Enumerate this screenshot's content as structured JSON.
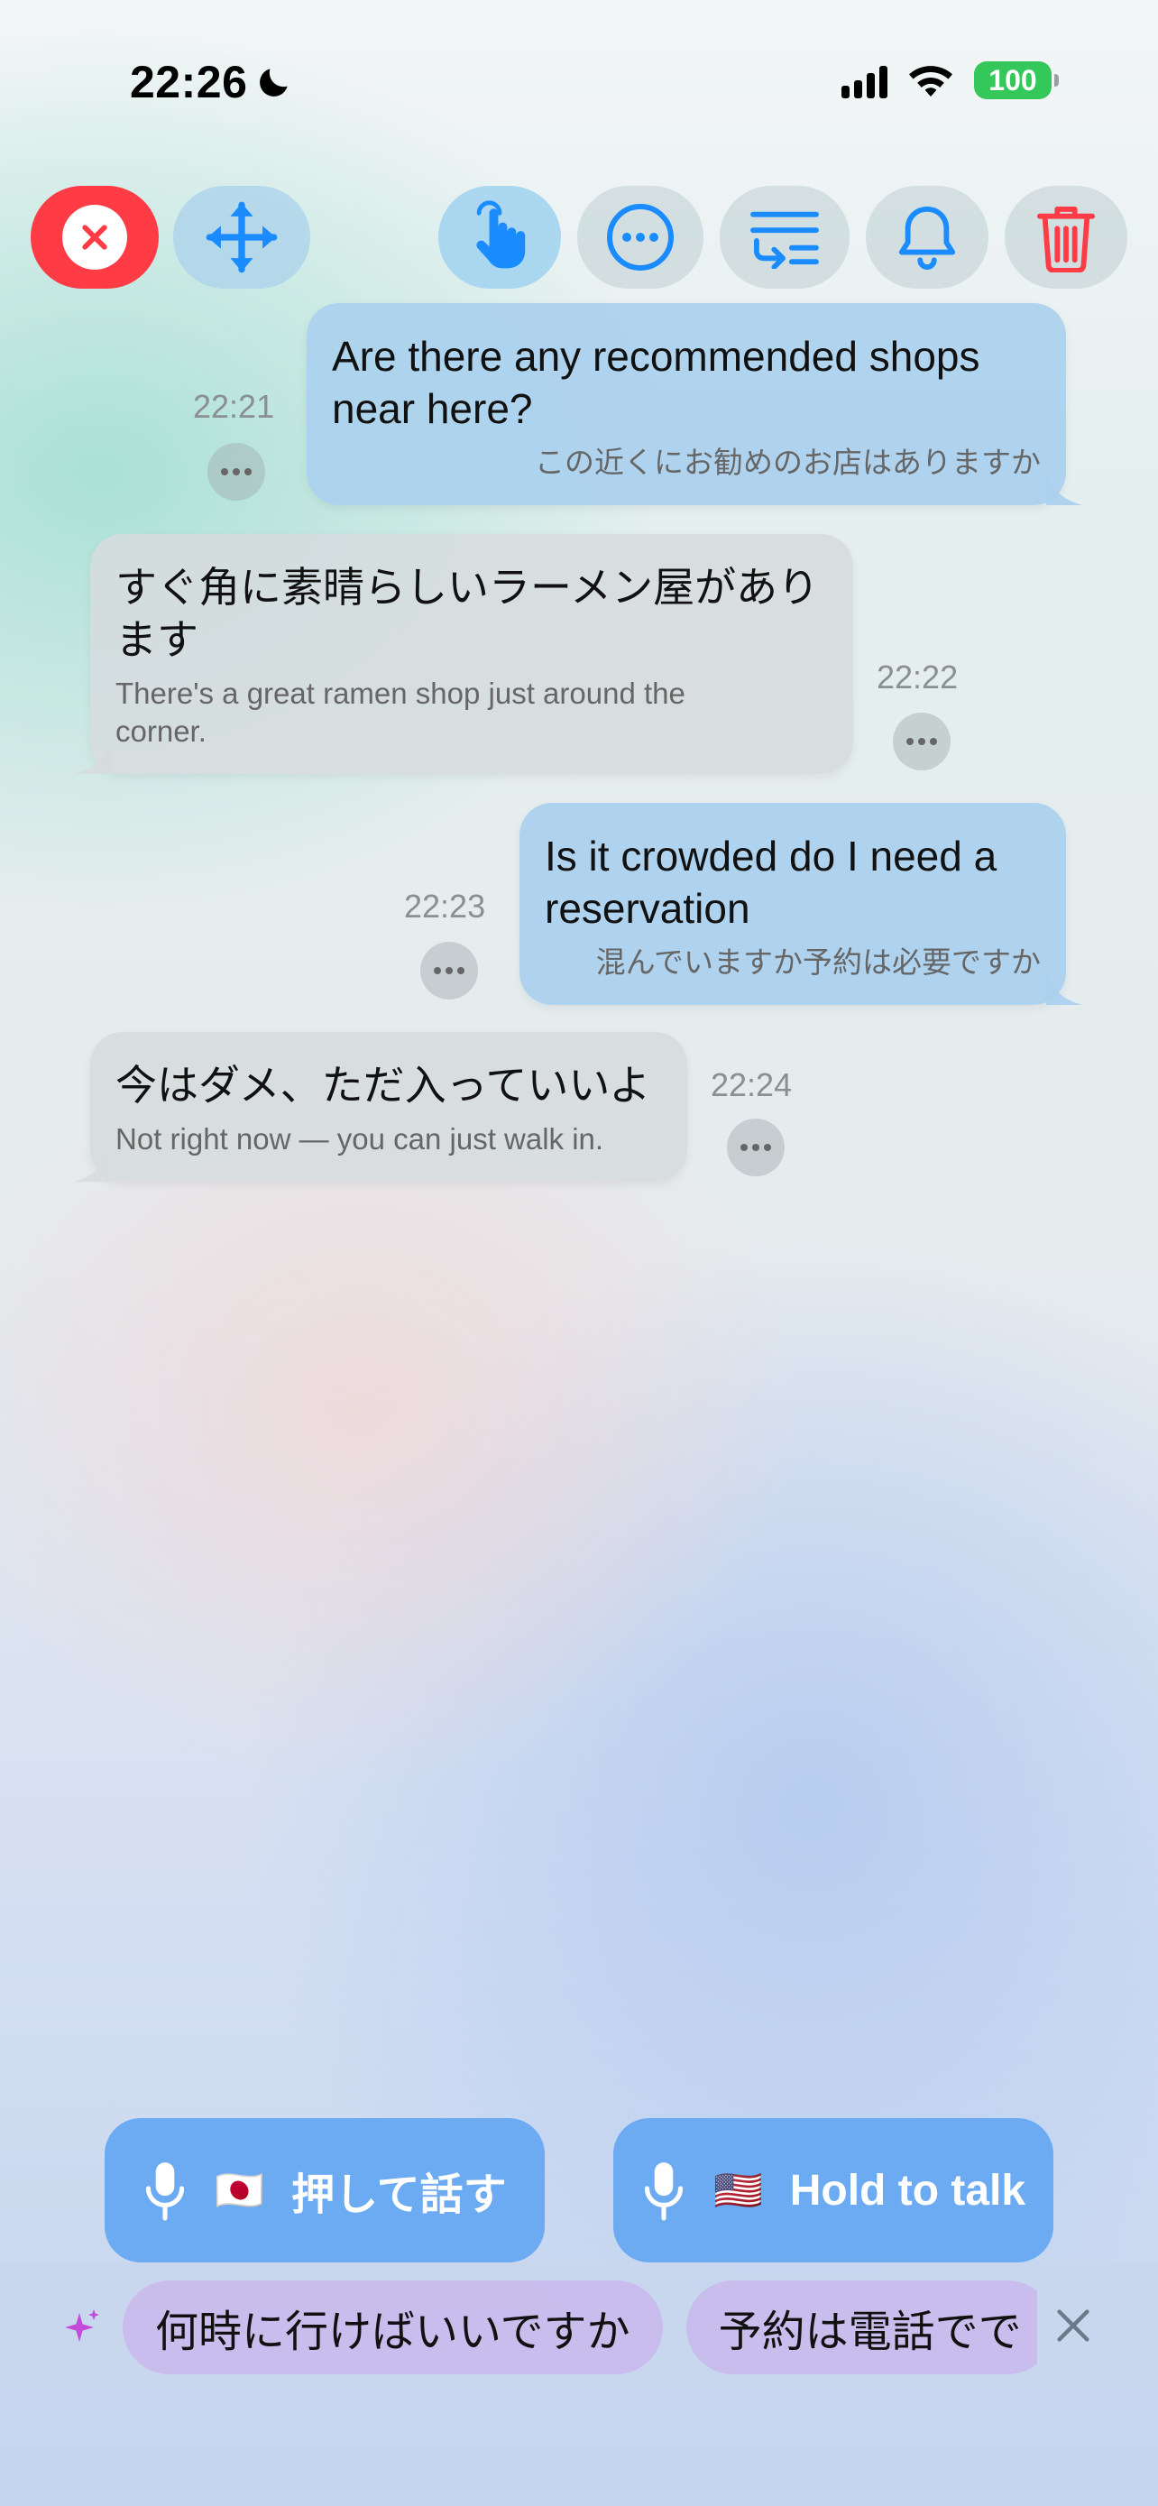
{
  "status_bar": {
    "time": "22:26",
    "battery": "100"
  },
  "toolbar": {
    "icons": [
      "close-icon",
      "move-icon",
      "touch-icon",
      "more-icon",
      "translate-swap-icon",
      "bell-icon",
      "trash-icon"
    ]
  },
  "messages": [
    {
      "side": "me",
      "main": "Are there any recommended shops near here?",
      "sub": "この近くにお勧めのお店はありますか",
      "time": "22:21"
    },
    {
      "side": "them",
      "main": "すぐ角に素晴らしいラーメン屋があります",
      "sub": "There's a great ramen shop just around the corner.",
      "time": "22:22"
    },
    {
      "side": "me",
      "main": "Is it crowded do I need a reservation",
      "sub": "混んでいますか予約は必要ですか",
      "time": "22:23"
    },
    {
      "side": "them",
      "main": "今はダメ、ただ入っていいよ",
      "sub": "Not right now — you can just walk in.",
      "time": "22:24"
    }
  ],
  "talk_buttons": {
    "ja": {
      "flag": "🇯🇵",
      "label": "押して話す"
    },
    "en": {
      "flag": "🇺🇸",
      "label": "Hold to talk"
    }
  },
  "suggestions": [
    "何時に行けばいいですか",
    "予約は電話でで"
  ],
  "colors": {
    "accent_blue": "#1a8cff",
    "close_red": "#ff3b45",
    "talk_blue": "#6caaf2",
    "battery_green": "#34c759"
  }
}
